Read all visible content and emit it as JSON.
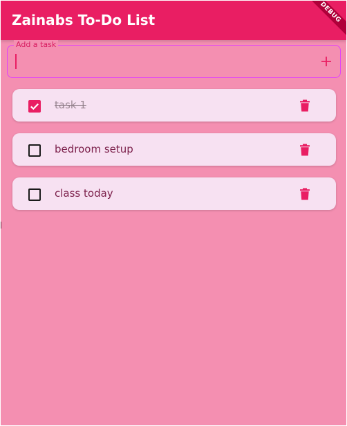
{
  "colors": {
    "app_bar": "#e91e63",
    "background": "#f48fb1",
    "card": "#f7e1f2",
    "accent": "#e91e63",
    "input_border": "#e040fb",
    "debug_banner": "#b0003a"
  },
  "app_bar": {
    "title": "Zainabs To-Do List",
    "debug_label": "DEBUG"
  },
  "task_input": {
    "label": "Add a task",
    "value": "",
    "add_icon": "plus-icon"
  },
  "tasks": [
    {
      "text": "task 1",
      "completed": true,
      "delete_icon": "trash-icon"
    },
    {
      "text": "bedroom setup",
      "completed": false,
      "delete_icon": "trash-icon"
    },
    {
      "text": "class today",
      "completed": false,
      "delete_icon": "trash-icon"
    }
  ]
}
